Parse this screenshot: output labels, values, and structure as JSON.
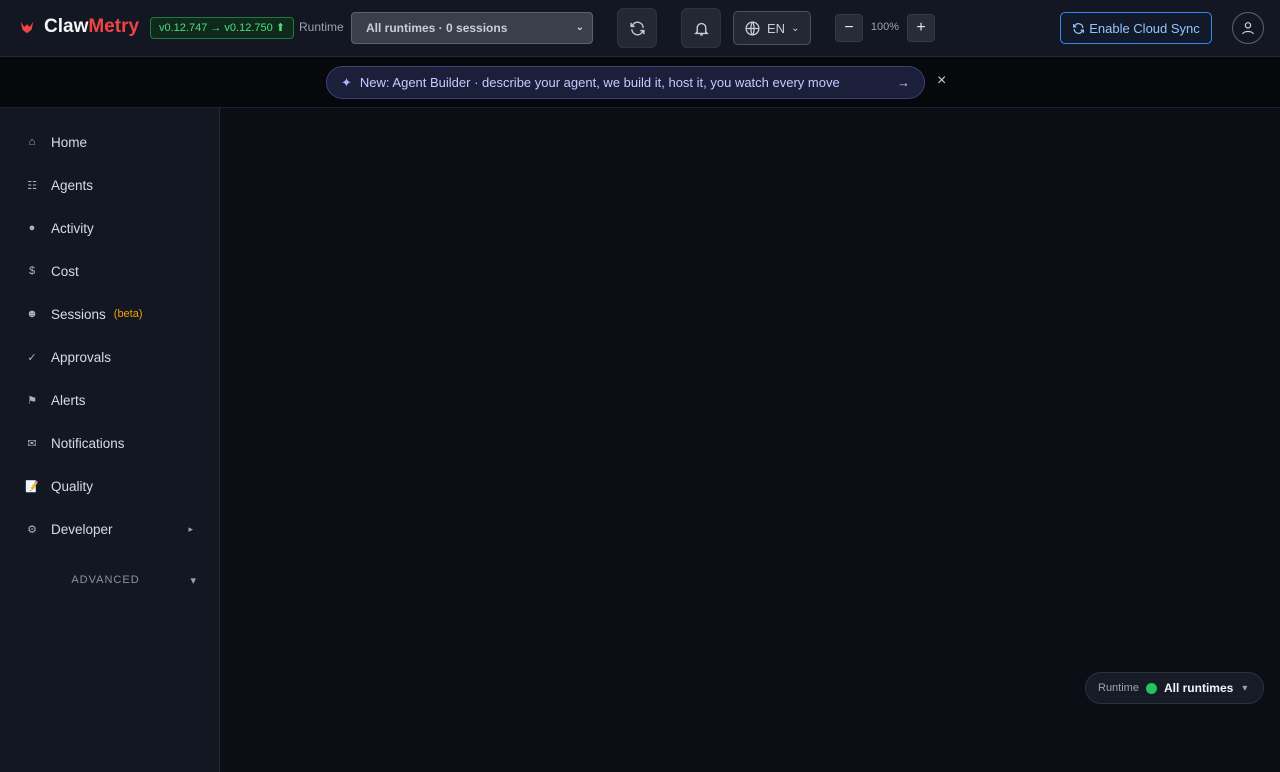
{
  "brand": {
    "part1": "Claw",
    "part2": "Metry",
    "logo_icon": "claw-logo-icon",
    "accent": "#ef4444"
  },
  "version": {
    "text": "v0.12.747 → v0.12.750 ⬆"
  },
  "runtime": {
    "label": "Runtime",
    "selected": "All runtimes · 0 sessions"
  },
  "language": {
    "code": "EN"
  },
  "zoom": {
    "minus": "−",
    "plus": "+",
    "value": "100%"
  },
  "cloud_sync": {
    "label": "Enable Cloud Sync"
  },
  "banner": {
    "text": "New: Agent Builder · describe your agent, we build it, host it, you watch every move",
    "arrow": "→",
    "close": "×"
  },
  "sidebar": {
    "items": [
      {
        "label": "Home",
        "icon": "⌂"
      },
      {
        "label": "Agents",
        "icon": "☷"
      },
      {
        "label": "Activity",
        "icon": "●"
      },
      {
        "label": "Cost",
        "icon": "$"
      },
      {
        "label": "Sessions",
        "icon": "☻",
        "badge": "(beta)"
      },
      {
        "label": "Approvals",
        "icon": "✓"
      },
      {
        "label": "Alerts",
        "icon": "⚑"
      },
      {
        "label": "Notifications",
        "icon": "✉"
      },
      {
        "label": "Quality",
        "icon": "📝"
      },
      {
        "label": "Developer",
        "icon": "⚙",
        "chevron": "▸"
      }
    ],
    "advanced": "ADVANCED",
    "advanced_toggle": "▾"
  },
  "runtime_pill": {
    "label": "Runtime",
    "value": "All runtimes",
    "status_color": "#22c55e",
    "caret": "▾"
  }
}
